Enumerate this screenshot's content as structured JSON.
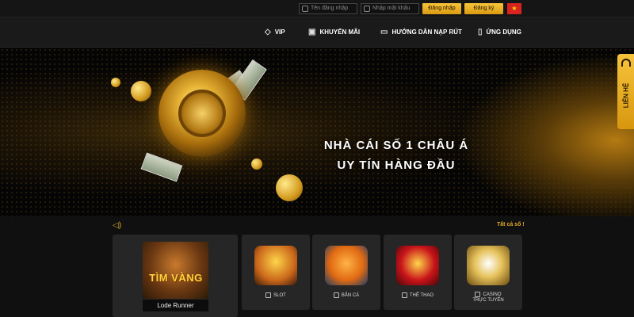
{
  "topbar": {
    "username_placeholder": "Tên đăng nhập",
    "password_placeholder": "Nhập mật khẩu",
    "login_label": "Đăng nhập",
    "register_label": "Đăng ký",
    "language_flag": "★"
  },
  "nav": {
    "items": [
      {
        "label": "VIP",
        "icon": "diamond-icon",
        "glyph": "◇"
      },
      {
        "label": "KHUYẾN MÃI",
        "icon": "gift-icon",
        "glyph": "▣"
      },
      {
        "label": "HƯỚNG DẪN NẠP RÚT",
        "icon": "wallet-icon",
        "glyph": "▭"
      },
      {
        "label": "ỨNG DỤNG",
        "icon": "mobile-icon",
        "glyph": "▯"
      }
    ]
  },
  "banner": {
    "line1": "NHÀ CÁI SỐ 1 CHÂU Á",
    "line2": "UY TÍN HÀNG ĐẦU",
    "slide_count": 5,
    "active_slide": 1
  },
  "contact_tab": {
    "label": "LIÊN HỆ"
  },
  "lottery": {
    "see_all_label": "Tất cả số !",
    "featured": {
      "art_text": "TÌM VÀNG",
      "title": "Lode Runner"
    },
    "categories": [
      {
        "label": "SLOT",
        "icon": "slot-machine-icon"
      },
      {
        "label": "BẮN CÁ",
        "icon": "fish-icon"
      },
      {
        "label": "THỂ THAO",
        "icon": "soccer-ball-icon"
      },
      {
        "label": "CASINO\nTRỰC TUYẾN",
        "icon": "playing-cards-icon"
      }
    ]
  },
  "colors": {
    "accent": "#e2aa2a",
    "button_gold": "#f8c53a",
    "background": "#0e0e0e"
  }
}
